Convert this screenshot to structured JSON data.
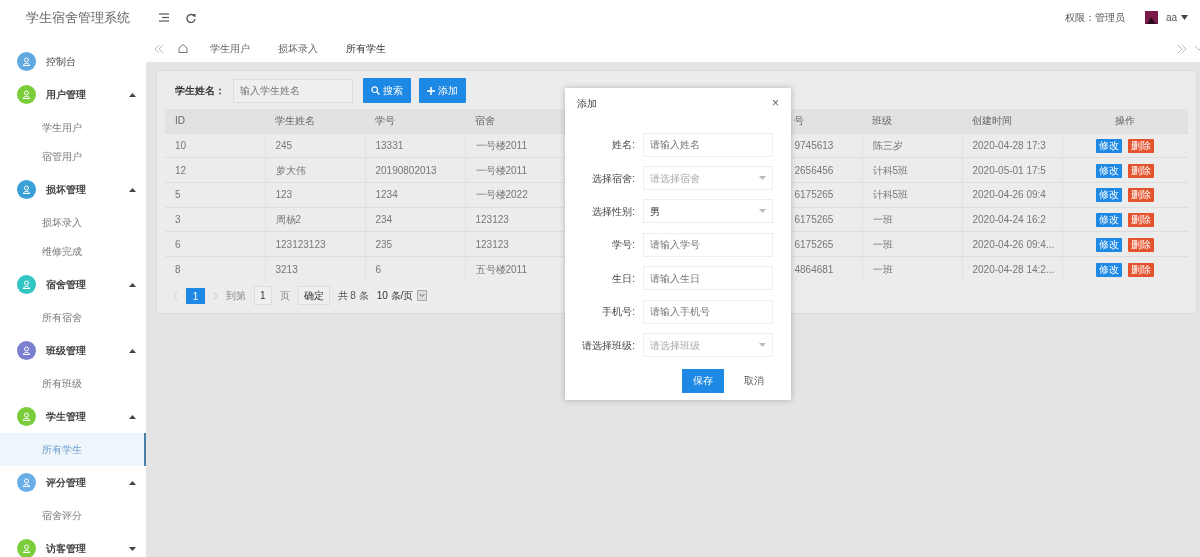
{
  "header": {
    "title": "学生宿舍管理系统",
    "role": "权限：管理员",
    "user": "aa"
  },
  "sidebar": {
    "items": [
      {
        "label": "控制台",
        "kind": "link",
        "color": "#5fa8e0"
      },
      {
        "label": "用户管理",
        "kind": "group",
        "color": "#7ccd3c",
        "expanded": true,
        "children": [
          {
            "label": "学生用户",
            "selected": false
          },
          {
            "label": "宿管用户",
            "selected": false
          }
        ]
      },
      {
        "label": "损坏管理",
        "kind": "group",
        "color": "#3a9fd6",
        "expanded": true,
        "children": [
          {
            "label": "损坏录入",
            "selected": false
          },
          {
            "label": "维修完成",
            "selected": false
          }
        ]
      },
      {
        "label": "宿舍管理",
        "kind": "group",
        "color": "#33c4c4",
        "expanded": true,
        "children": [
          {
            "label": "所有宿舍",
            "selected": false
          }
        ]
      },
      {
        "label": "班级管理",
        "kind": "group",
        "color": "#7b7fd0",
        "expanded": true,
        "children": [
          {
            "label": "所有班级",
            "selected": false
          }
        ]
      },
      {
        "label": "学生管理",
        "kind": "group",
        "color": "#7ccd3c",
        "expanded": true,
        "children": [
          {
            "label": "所有学生",
            "selected": true
          }
        ]
      },
      {
        "label": "评分管理",
        "kind": "group",
        "color": "#6aaee8",
        "expanded": true,
        "children": [
          {
            "label": "宿舍评分",
            "selected": false
          }
        ]
      },
      {
        "label": "访客管理",
        "kind": "group",
        "color": "#7ccd3c",
        "expanded": false
      }
    ]
  },
  "tabs": [
    {
      "label": "学生用户",
      "selected": false
    },
    {
      "label": "损坏录入",
      "selected": false
    },
    {
      "label": "所有学生",
      "selected": true
    }
  ],
  "search": {
    "label": "学生姓名：",
    "placeholder": "输入学生姓名",
    "buttons": [
      "搜索",
      "添加"
    ]
  },
  "table": {
    "columns": [
      "ID",
      "学生姓名",
      "学号",
      "宿舍",
      "",
      "号",
      "班级",
      "创建时间",
      "操作"
    ],
    "rows": [
      {
        "cells": [
          "10",
          "245",
          "13331",
          "一号楼2011",
          "",
          "9745613",
          "陈三岁",
          "2020-04-28 17:3"
        ],
        "actions": [
          "修改",
          "删除"
        ]
      },
      {
        "cells": [
          "12",
          "萝大伟",
          "20190802013",
          "一号楼2011",
          "",
          "2656456",
          "计科5班",
          "2020-05-01 17:5"
        ],
        "actions": [
          "修改",
          "删除"
        ]
      },
      {
        "cells": [
          "5",
          "123",
          "1234",
          "一号楼2022",
          "",
          "6175265",
          "计科5班",
          "2020-04-26 09:4"
        ],
        "actions": [
          "修改",
          "删除"
        ]
      },
      {
        "cells": [
          "3",
          "周杨2",
          "234",
          "123123",
          "",
          "6175265",
          "一班",
          "2020-04-24 16:2"
        ],
        "actions": [
          "修改",
          "删除"
        ]
      },
      {
        "cells": [
          "6",
          "123123123",
          "235",
          "123123",
          "",
          "6175265",
          "一班",
          "2020-04-26 09:4..."
        ],
        "actions": [
          "修改",
          "删除"
        ]
      },
      {
        "cells": [
          "8",
          "3213",
          "6",
          "五号楼2011",
          "",
          "4864681",
          "一班",
          "2020-04-28 14:2..."
        ],
        "actions": [
          "修改",
          "删除"
        ]
      }
    ]
  },
  "pagination": {
    "current": "1",
    "goto": "到第",
    "page_input": "1",
    "page_unit": "页",
    "confirm": "确定",
    "total": "共 8 条",
    "page_size": "10 条/页"
  },
  "modal": {
    "title": "添加",
    "close": "×",
    "fields": [
      {
        "label": "姓名:",
        "kind": "input",
        "placeholder": "请输入姓名"
      },
      {
        "label": "选择宿舍:",
        "kind": "select",
        "placeholder": "请选择宿舍"
      },
      {
        "label": "选择性别:",
        "kind": "select",
        "value": "男"
      },
      {
        "label": "学号:",
        "kind": "input",
        "placeholder": "请输入学号"
      },
      {
        "label": "生日:",
        "kind": "input",
        "placeholder": "请输入生日"
      },
      {
        "label": "手机号:",
        "kind": "input",
        "placeholder": "请输入手机号"
      },
      {
        "label": "请选择班级:",
        "kind": "select",
        "placeholder": "请选择班级"
      }
    ],
    "buttons": [
      "保存",
      "取消"
    ]
  }
}
